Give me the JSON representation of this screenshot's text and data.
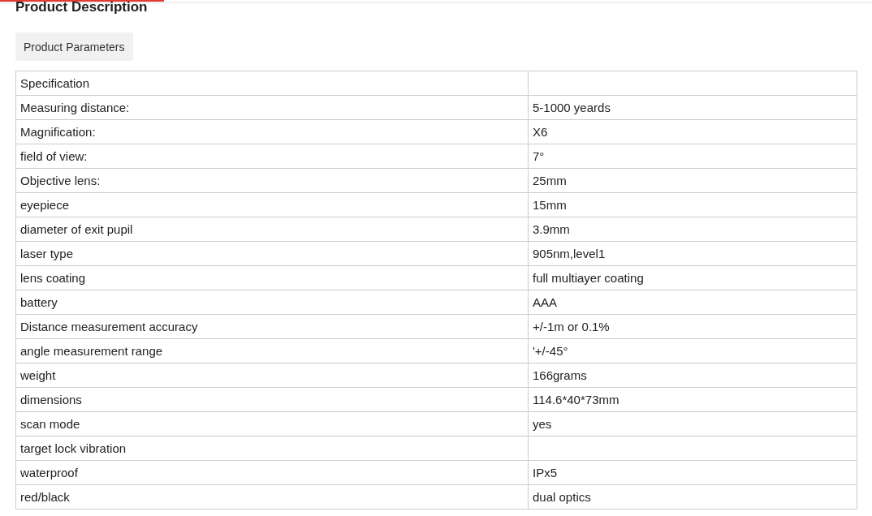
{
  "heading": "Product Description",
  "parameters_button": "Product Parameters",
  "table": {
    "rows": [
      [
        "Specification",
        ""
      ],
      [
        "Measuring distance:",
        "5-1000 yeards"
      ],
      [
        "Magnification:",
        "X6"
      ],
      [
        "field of view:",
        "7°"
      ],
      [
        "Objective lens:",
        "25mm"
      ],
      [
        "eyepiece",
        "15mm"
      ],
      [
        "diameter of exit pupil",
        "3.9mm"
      ],
      [
        "laser type",
        "905nm,level1"
      ],
      [
        "lens coating",
        "full multiayer coating"
      ],
      [
        "battery",
        "AAA"
      ],
      [
        "Distance measurement accuracy",
        "+/-1m or 0.1%"
      ],
      [
        "angle measurement range",
        "'+/-45°"
      ],
      [
        "weight",
        "166grams"
      ],
      [
        "dimensions",
        "114.6*40*73mm"
      ],
      [
        "scan mode",
        "yes"
      ],
      [
        "target lock vibration",
        ""
      ],
      [
        "waterproof",
        "IPx5"
      ],
      [
        "red/black",
        "dual optics"
      ]
    ]
  }
}
